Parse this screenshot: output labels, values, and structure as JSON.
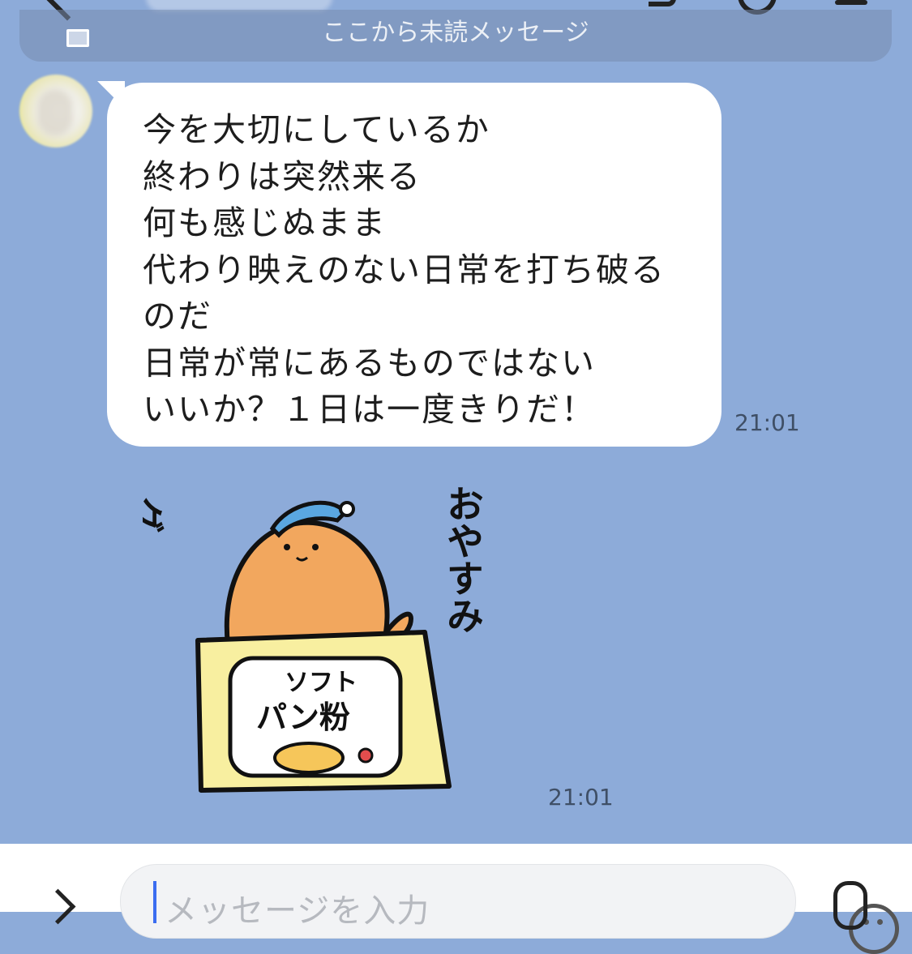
{
  "unread_divider": {
    "text": "ここから未読メッセージ"
  },
  "messages": [
    {
      "sender": "other",
      "type": "text",
      "lines": [
        "今を大切にしているか",
        "終わりは突然来る",
        "何も感じぬまま",
        "代わり映えのない日常を打ち破る",
        "のだ",
        "日常が常にあるものではない",
        "いいか？１日は一度きりだ！"
      ],
      "time": "21:01"
    },
    {
      "sender": "other",
      "type": "sticker",
      "sticker_text": {
        "left": "グッナイ",
        "right": "おやすみ",
        "bag": [
          "ソフト",
          "パン粉"
        ]
      },
      "time": "21:01"
    }
  ],
  "composer": {
    "placeholder": "メッセージを入力"
  },
  "icons": {
    "back": "chevron-left-icon",
    "expand": "chevron-right-icon",
    "emoji": "smiley-icon",
    "mic": "microphone-icon"
  },
  "colors": {
    "chat_background": "#8dabd9",
    "bubble": "#ffffff",
    "caret": "#3b6df0",
    "avatar_ring": "#f1ec4a"
  }
}
